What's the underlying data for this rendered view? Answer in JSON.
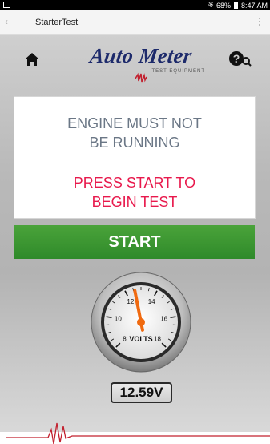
{
  "status_bar": {
    "battery_percent": "68%",
    "time": "8:47 AM",
    "icons": [
      "bluetooth-icon",
      "battery-icon"
    ]
  },
  "title_bar": {
    "title": "StarterTest",
    "icons": [
      "back-icon",
      "overflow-menu-icon"
    ]
  },
  "header": {
    "brand_name": "Auto Meter",
    "brand_subtitle": "TEST EQUIPMENT",
    "icons": [
      "home-icon",
      "help-icon"
    ]
  },
  "message": {
    "warning_lines": [
      "ENGINE MUST NOT",
      "BE RUNNING"
    ],
    "action_lines": [
      "PRESS START TO",
      "BEGIN TEST"
    ]
  },
  "start_button": {
    "label": "START"
  },
  "gauge": {
    "tick_labels": [
      "8",
      "10",
      "12",
      "14",
      "16",
      "18"
    ],
    "unit_label": "VOLTS",
    "needle_value": 12.59
  },
  "readout": {
    "value": "12.59V"
  },
  "colors": {
    "warning_text": "#6b7786",
    "action_text": "#e8194c",
    "start_button": "#3a962f",
    "brand": "#1d2a6b",
    "accent_red": "#c2202e"
  }
}
